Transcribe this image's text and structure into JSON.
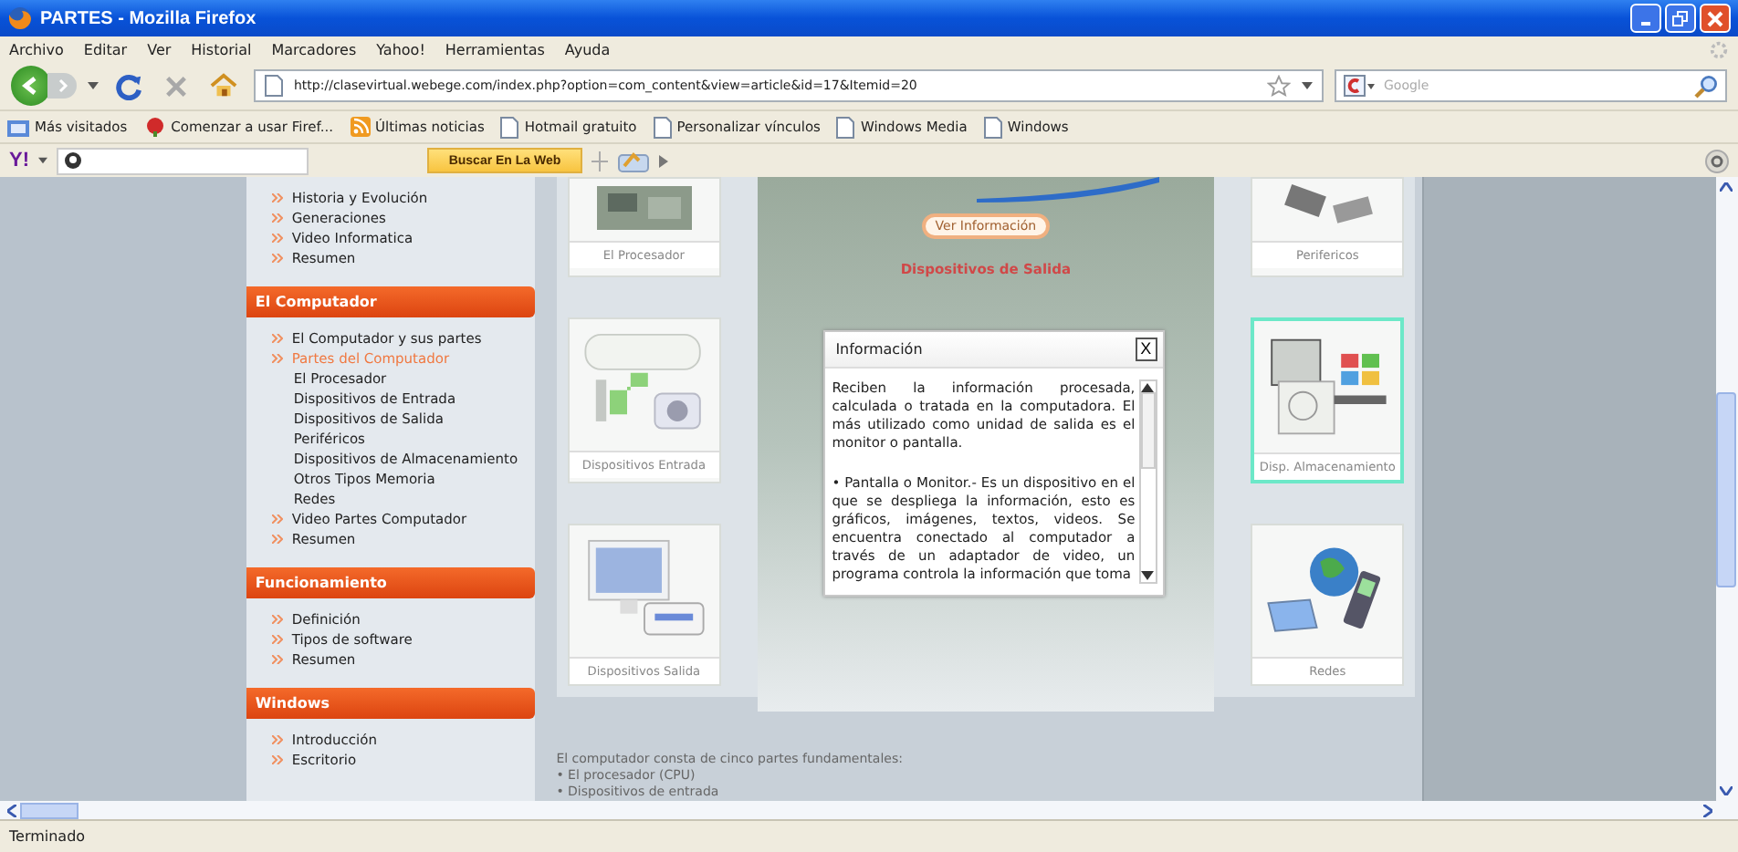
{
  "window": {
    "title": "PARTES - Mozilla Firefox"
  },
  "menu_bar": [
    "Archivo",
    "Editar",
    "Ver",
    "Historial",
    "Marcadores",
    "Yahoo!",
    "Herramientas",
    "Ayuda"
  ],
  "navigation": {
    "url": "http://clasevirtual.webege.com/index.php?option=com_content&view=article&id=17&Itemid=20",
    "search_placeholder": "Google"
  },
  "bookmarks": [
    "Más visitados",
    "Comenzar a usar Firef...",
    "Últimas noticias",
    "Hotmail gratuito",
    "Personalizar vínculos",
    "Windows Media",
    "Windows"
  ],
  "yahoo_toolbar": {
    "logo": "Y!",
    "search_button": "Buscar En La Web"
  },
  "sidebar": {
    "sections": [
      {
        "items": [
          {
            "label": "Historia y Evolución",
            "selected": false
          },
          {
            "label": "Generaciones",
            "selected": false
          },
          {
            "label": "Video Informatica",
            "selected": false
          },
          {
            "label": "Resumen",
            "selected": false
          }
        ]
      },
      {
        "title": "El Computador",
        "items": [
          {
            "label": "El Computador y sus partes",
            "selected": false
          },
          {
            "label": "Partes del Computador",
            "selected": true,
            "children": [
              {
                "label": "El Procesador",
                "selected": false
              },
              {
                "label": "Dispositivos de Entrada",
                "selected": false
              },
              {
                "label": "Dispositivos de Salida",
                "selected": false
              },
              {
                "label": "Periféricos",
                "selected": false
              },
              {
                "label": "Dispositivos de Almacenamiento",
                "selected": false
              },
              {
                "label": "Otros Tipos Memoria",
                "selected": false
              },
              {
                "label": "Redes",
                "selected": false
              }
            ]
          },
          {
            "label": "Video Partes Computador",
            "selected": false
          },
          {
            "label": "Resumen",
            "selected": false
          }
        ]
      },
      {
        "title": "Funcionamiento",
        "items": [
          {
            "label": "Definición",
            "selected": false
          },
          {
            "label": "Tipos de software",
            "selected": false
          },
          {
            "label": "Resumen",
            "selected": false
          }
        ]
      },
      {
        "title": "Windows",
        "items": [
          {
            "label": "Introducción",
            "selected": false
          },
          {
            "label": "Escritorio",
            "selected": false
          }
        ]
      }
    ]
  },
  "main": {
    "tiles": [
      {
        "label": "El Procesador",
        "selected": false
      },
      {
        "label": "Perifericos",
        "selected": false
      },
      {
        "label": "Dispositivos Entrada",
        "selected": false
      },
      {
        "label": "Disp. Almacenamiento",
        "selected": true
      },
      {
        "label": "Dispositivos Salida",
        "selected": false
      },
      {
        "label": "Redes",
        "selected": false
      }
    ],
    "info_button": "Ver Información",
    "section_title": "Dispositivos de Salida",
    "dialog": {
      "title": "Información",
      "close": "X",
      "paragraphs": [
        "Reciben la información procesada, calculada o tratada en la computadora. El más utilizado como unidad de salida es el monitor o pantalla.",
        "• Pantalla o Monitor.-  Es un dispositivo en el que se despliega la información, esto es gráficos, imágenes, textos, videos. Se encuentra conectado al computador a través de un adaptador de video, un programa controla la información que toma"
      ]
    },
    "intro": {
      "text": "El computador consta de cinco partes fundamentales:",
      "bullets": [
        "• El procesador  (CPU)",
        "• Dispositivos de entrada"
      ]
    }
  },
  "status_bar": {
    "text": "Terminado"
  }
}
